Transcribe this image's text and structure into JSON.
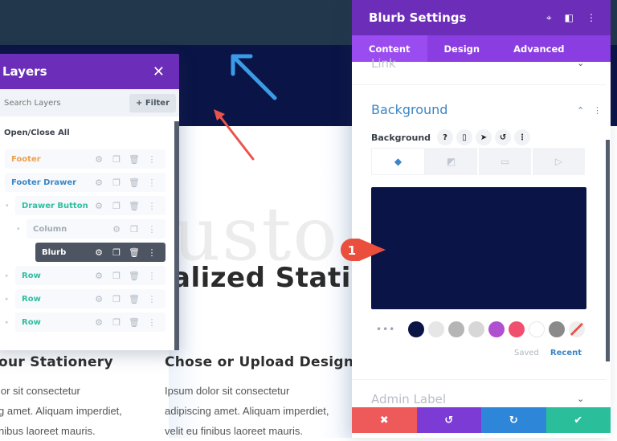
{
  "page": {
    "ghost_word": "usto",
    "heading": "alized Statio",
    "columns": [
      {
        "heading": "our Stationery",
        "lines": [
          "lor sit consectetur",
          "g amet. Aliquam imperdiet,",
          "nibus laoreet mauris."
        ]
      },
      {
        "heading": "Chose or Upload Design",
        "lines": [
          "Ipsum dolor sit consectetur",
          "adipiscing amet. Aliquam imperdiet,",
          "velit eu finibus laoreet mauris."
        ]
      }
    ],
    "colors": {
      "topbar": "#22364c",
      "hero": "#0b1446"
    }
  },
  "annotations": {
    "blue_arrow_color": "#3a9be8",
    "red_arrow_color": "#e9544a",
    "step_badge": "1"
  },
  "layers": {
    "title": "Layers",
    "close_icon": "close-icon",
    "search_placeholder": "Search Layers",
    "filter_label": "+ Filter",
    "open_close_all": "Open/Close All",
    "items": [
      {
        "label": "Footer",
        "color": "#f0a04b",
        "level": 0,
        "icons": [
          "gear-icon",
          "duplicate-icon",
          "trash-icon",
          "more-icon"
        ]
      },
      {
        "label": "Footer Drawer",
        "color": "#3b86c6",
        "level": 0,
        "icons": [
          "gear-icon",
          "duplicate-icon",
          "trash-icon",
          "more-icon"
        ]
      },
      {
        "label": "Drawer Button",
        "color": "#2ebfa0",
        "level": 1,
        "icons": [
          "gear-icon",
          "duplicate-icon",
          "trash-icon",
          "more-icon"
        ]
      },
      {
        "label": "Column",
        "color": "#a3abb6",
        "level": 2,
        "icons": [
          "gear-icon",
          "duplicate-icon",
          "more-icon"
        ]
      },
      {
        "label": "Blurb",
        "color": "#ffffff",
        "level": 3,
        "active": true,
        "icons": [
          "gear-icon",
          "duplicate-icon",
          "trash-icon",
          "more-icon"
        ]
      },
      {
        "label": "Row",
        "color": "#2ebfa0",
        "level": 1,
        "icons": [
          "gear-icon",
          "duplicate-icon",
          "trash-icon",
          "more-icon"
        ]
      },
      {
        "label": "Row",
        "color": "#2ebfa0",
        "level": 1,
        "icons": [
          "gear-icon",
          "duplicate-icon",
          "trash-icon",
          "more-icon"
        ]
      },
      {
        "label": "Row",
        "color": "#2ebfa0",
        "level": 1,
        "icons": [
          "gear-icon",
          "duplicate-icon",
          "trash-icon",
          "more-icon"
        ]
      }
    ]
  },
  "settings": {
    "title": "Blurb Settings",
    "header_icons": [
      "focus-icon",
      "split-view-icon",
      "more-icon"
    ],
    "tabs": [
      {
        "label": "Content",
        "active": true
      },
      {
        "label": "Design",
        "active": false
      },
      {
        "label": "Advanced",
        "active": false
      }
    ],
    "link_section": "Link",
    "background_section": "Background",
    "background_label": "Background",
    "background_label_icons": [
      "?",
      "mobile-icon",
      "cursor-icon",
      "reset-icon",
      "more-icon"
    ],
    "background_types": [
      "color-fill-icon",
      "gradient-icon",
      "image-icon",
      "video-icon"
    ],
    "selected_color": "#0b1446",
    "swatches_more": "•••",
    "swatches": [
      "#0b1446",
      "#e6e6e6",
      "#b5b5b5",
      "#d7d7d7",
      "#b04fd0",
      "#f0506e",
      "#ffffff",
      "#8a8a8a",
      "transparent"
    ],
    "saved_label": "Saved",
    "recent_label": "Recent",
    "admin_label": "Admin Label",
    "actions": [
      {
        "name": "cancel",
        "glyph": "✖",
        "color": "#ee5a5a"
      },
      {
        "name": "undo",
        "glyph": "↺",
        "color": "#7d3bd6"
      },
      {
        "name": "redo",
        "glyph": "↻",
        "color": "#2e86d8"
      },
      {
        "name": "save",
        "glyph": "✔",
        "color": "#2bbe9a"
      }
    ]
  }
}
